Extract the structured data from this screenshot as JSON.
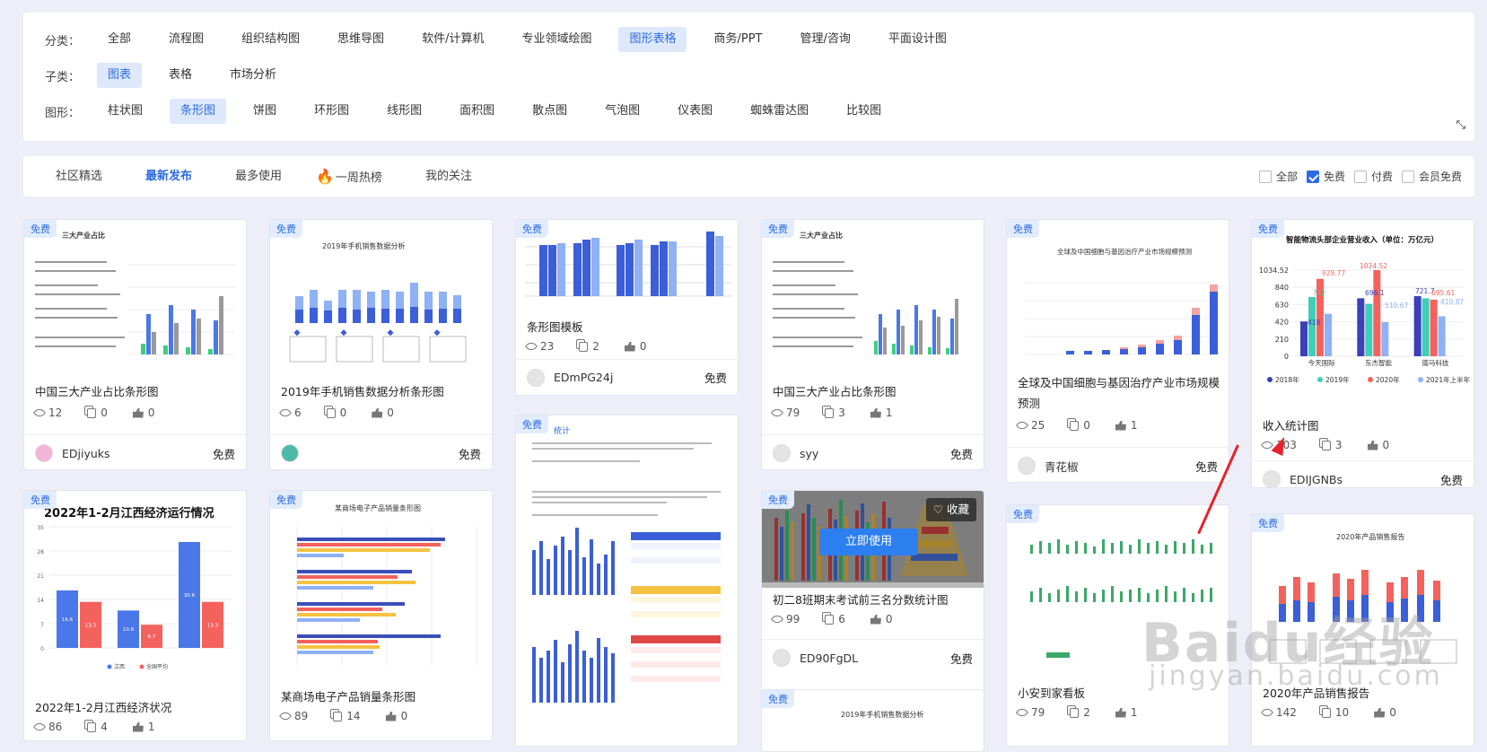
{
  "filters": {
    "category": {
      "label": "分类：",
      "items": [
        "全部",
        "流程图",
        "组织结构图",
        "思维导图",
        "软件/计算机",
        "专业领域绘图",
        "图形表格",
        "商务/PPT",
        "管理/咨询",
        "平面设计图"
      ],
      "selected": "图形表格"
    },
    "subcategory": {
      "label": "子类：",
      "items": [
        "图表",
        "表格",
        "市场分析"
      ],
      "selected": "图表"
    },
    "shape": {
      "label": "图形：",
      "items": [
        "柱状图",
        "条形图",
        "饼图",
        "环形图",
        "线形图",
        "面积图",
        "散点图",
        "气泡图",
        "仪表图",
        "蜘蛛雷达图",
        "比较图"
      ],
      "selected": "条形图"
    }
  },
  "tabs": [
    "社区精选",
    "最新发布",
    "最多使用",
    "一周热榜",
    "我的关注"
  ],
  "active_tab": "最新发布",
  "checks": [
    {
      "label": "全部",
      "checked": false
    },
    {
      "label": "免费",
      "checked": true
    },
    {
      "label": "付费",
      "checked": false
    },
    {
      "label": "会员免费",
      "checked": false
    }
  ],
  "badge": "免费",
  "overlay": {
    "use": "立即使用",
    "fav": "收藏"
  },
  "cards": [
    {
      "title": "中国三大产业占比条形图",
      "views": "12",
      "copies": "0",
      "likes": "0",
      "user": "EDjiyuks",
      "price": "免费",
      "thumb_title": "三大产业占比"
    },
    {
      "title": "2019年手机销售数据分析条形图",
      "views": "6",
      "copies": "0",
      "likes": "0",
      "user": "",
      "price": "免费",
      "thumb_title": "2019年手机销售数据分析"
    },
    {
      "title": "条形图模板",
      "views": "23",
      "copies": "2",
      "likes": "0",
      "user": "EDmPG24j",
      "price": "免费"
    },
    {
      "title": "中国三大产业占比条形图",
      "views": "79",
      "copies": "3",
      "likes": "1",
      "user": "syy",
      "price": "免费",
      "thumb_title": "三大产业占比"
    },
    {
      "title": "全球及中国细胞与基因治疗产业市场规模预测",
      "views": "25",
      "copies": "0",
      "likes": "1",
      "user": "青花椒",
      "price": "免费",
      "thumb_title": "全球及中国细胞与基因治疗产业市场规模预测"
    },
    {
      "title": "收入统计图",
      "views": "103",
      "copies": "3",
      "likes": "0",
      "user": "EDIJGNBs",
      "price": "免费",
      "thumb_title": "智能物流头部企业营业收入（单位：万亿元）"
    },
    {
      "title": "2022年1-2月江西经济状况",
      "views": "86",
      "copies": "4",
      "likes": "1",
      "thumb_title": "2022年1-2月江西经济运行情况"
    },
    {
      "title": "某商场电子产品销量条形图",
      "views": "89",
      "copies": "14",
      "likes": "0",
      "thumb_title": "某商场电子产品销量条形图"
    },
    {
      "title": "",
      "thumb_title": "统计"
    },
    {
      "title": "初二8班期末考试前三名分数统计图",
      "views": "99",
      "copies": "6",
      "likes": "0",
      "user": "ED90FgDL",
      "price": "免费"
    },
    {
      "title": "小安到家看板",
      "views": "79",
      "copies": "2",
      "likes": "1"
    },
    {
      "title": "2020年产品销售报告",
      "views": "142",
      "copies": "10",
      "likes": "0",
      "thumb_title": "2020年产品销售报告"
    },
    {
      "title": "",
      "thumb_title": "2019年手机销售数据分析"
    }
  ],
  "revenue_chart": {
    "yticks": [
      "1034.52",
      "840",
      "630",
      "420",
      "210",
      "0"
    ],
    "groups": [
      "今天国际",
      "东杰智能",
      "德马科技"
    ],
    "legend": [
      "2018年",
      "2019年",
      "2020年",
      "2021年上半年"
    ],
    "labels": [
      "418",
      "712",
      "929.77",
      "1034.52",
      "696.1",
      "721.7",
      "695.61",
      "510.67",
      "410.87"
    ]
  },
  "jiangxi_chart": {
    "yticks": [
      "35",
      "28",
      "21",
      "14",
      "7",
      "0"
    ],
    "values": [
      [
        16.6,
        13.3
      ],
      [
        10.8,
        6.7
      ],
      [
        30.6,
        13.3
      ]
    ],
    "legend": [
      "江西",
      "全国平均"
    ]
  },
  "watermark": {
    "brand": "Baidu经验",
    "url": "jingyan.baidu.com"
  },
  "colors": {
    "accent": "#2d6be4",
    "bar_blue": "#4a78e8",
    "bar_red": "#f4625e",
    "bar_teal": "#3ecfb8",
    "bar_light": "#8fb1f5"
  }
}
